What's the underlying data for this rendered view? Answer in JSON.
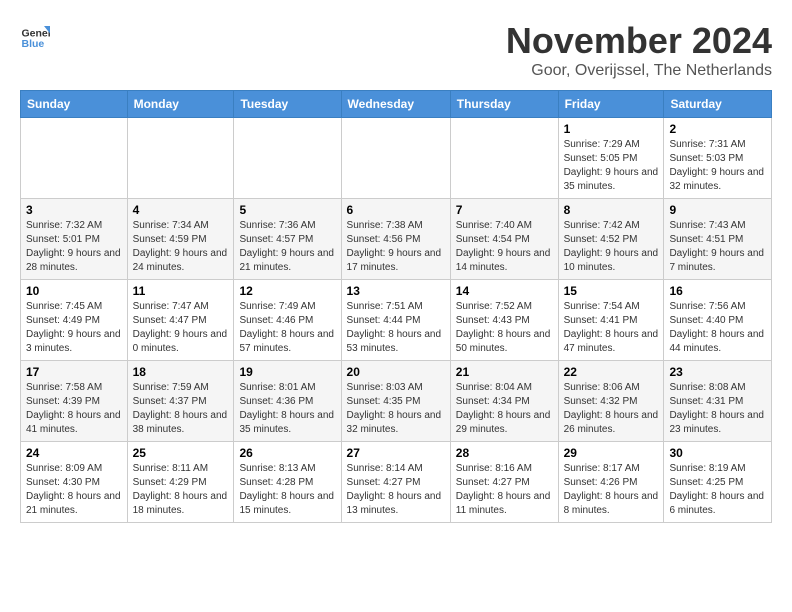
{
  "logo": {
    "text_general": "General",
    "text_blue": "Blue"
  },
  "header": {
    "month_year": "November 2024",
    "location": "Goor, Overijssel, The Netherlands"
  },
  "weekdays": [
    "Sunday",
    "Monday",
    "Tuesday",
    "Wednesday",
    "Thursday",
    "Friday",
    "Saturday"
  ],
  "weeks": [
    [
      {
        "day": "",
        "info": ""
      },
      {
        "day": "",
        "info": ""
      },
      {
        "day": "",
        "info": ""
      },
      {
        "day": "",
        "info": ""
      },
      {
        "day": "",
        "info": ""
      },
      {
        "day": "1",
        "info": "Sunrise: 7:29 AM\nSunset: 5:05 PM\nDaylight: 9 hours and 35 minutes."
      },
      {
        "day": "2",
        "info": "Sunrise: 7:31 AM\nSunset: 5:03 PM\nDaylight: 9 hours and 32 minutes."
      }
    ],
    [
      {
        "day": "3",
        "info": "Sunrise: 7:32 AM\nSunset: 5:01 PM\nDaylight: 9 hours and 28 minutes."
      },
      {
        "day": "4",
        "info": "Sunrise: 7:34 AM\nSunset: 4:59 PM\nDaylight: 9 hours and 24 minutes."
      },
      {
        "day": "5",
        "info": "Sunrise: 7:36 AM\nSunset: 4:57 PM\nDaylight: 9 hours and 21 minutes."
      },
      {
        "day": "6",
        "info": "Sunrise: 7:38 AM\nSunset: 4:56 PM\nDaylight: 9 hours and 17 minutes."
      },
      {
        "day": "7",
        "info": "Sunrise: 7:40 AM\nSunset: 4:54 PM\nDaylight: 9 hours and 14 minutes."
      },
      {
        "day": "8",
        "info": "Sunrise: 7:42 AM\nSunset: 4:52 PM\nDaylight: 9 hours and 10 minutes."
      },
      {
        "day": "9",
        "info": "Sunrise: 7:43 AM\nSunset: 4:51 PM\nDaylight: 9 hours and 7 minutes."
      }
    ],
    [
      {
        "day": "10",
        "info": "Sunrise: 7:45 AM\nSunset: 4:49 PM\nDaylight: 9 hours and 3 minutes."
      },
      {
        "day": "11",
        "info": "Sunrise: 7:47 AM\nSunset: 4:47 PM\nDaylight: 9 hours and 0 minutes."
      },
      {
        "day": "12",
        "info": "Sunrise: 7:49 AM\nSunset: 4:46 PM\nDaylight: 8 hours and 57 minutes."
      },
      {
        "day": "13",
        "info": "Sunrise: 7:51 AM\nSunset: 4:44 PM\nDaylight: 8 hours and 53 minutes."
      },
      {
        "day": "14",
        "info": "Sunrise: 7:52 AM\nSunset: 4:43 PM\nDaylight: 8 hours and 50 minutes."
      },
      {
        "day": "15",
        "info": "Sunrise: 7:54 AM\nSunset: 4:41 PM\nDaylight: 8 hours and 47 minutes."
      },
      {
        "day": "16",
        "info": "Sunrise: 7:56 AM\nSunset: 4:40 PM\nDaylight: 8 hours and 44 minutes."
      }
    ],
    [
      {
        "day": "17",
        "info": "Sunrise: 7:58 AM\nSunset: 4:39 PM\nDaylight: 8 hours and 41 minutes."
      },
      {
        "day": "18",
        "info": "Sunrise: 7:59 AM\nSunset: 4:37 PM\nDaylight: 8 hours and 38 minutes."
      },
      {
        "day": "19",
        "info": "Sunrise: 8:01 AM\nSunset: 4:36 PM\nDaylight: 8 hours and 35 minutes."
      },
      {
        "day": "20",
        "info": "Sunrise: 8:03 AM\nSunset: 4:35 PM\nDaylight: 8 hours and 32 minutes."
      },
      {
        "day": "21",
        "info": "Sunrise: 8:04 AM\nSunset: 4:34 PM\nDaylight: 8 hours and 29 minutes."
      },
      {
        "day": "22",
        "info": "Sunrise: 8:06 AM\nSunset: 4:32 PM\nDaylight: 8 hours and 26 minutes."
      },
      {
        "day": "23",
        "info": "Sunrise: 8:08 AM\nSunset: 4:31 PM\nDaylight: 8 hours and 23 minutes."
      }
    ],
    [
      {
        "day": "24",
        "info": "Sunrise: 8:09 AM\nSunset: 4:30 PM\nDaylight: 8 hours and 21 minutes."
      },
      {
        "day": "25",
        "info": "Sunrise: 8:11 AM\nSunset: 4:29 PM\nDaylight: 8 hours and 18 minutes."
      },
      {
        "day": "26",
        "info": "Sunrise: 8:13 AM\nSunset: 4:28 PM\nDaylight: 8 hours and 15 minutes."
      },
      {
        "day": "27",
        "info": "Sunrise: 8:14 AM\nSunset: 4:27 PM\nDaylight: 8 hours and 13 minutes."
      },
      {
        "day": "28",
        "info": "Sunrise: 8:16 AM\nSunset: 4:27 PM\nDaylight: 8 hours and 11 minutes."
      },
      {
        "day": "29",
        "info": "Sunrise: 8:17 AM\nSunset: 4:26 PM\nDaylight: 8 hours and 8 minutes."
      },
      {
        "day": "30",
        "info": "Sunrise: 8:19 AM\nSunset: 4:25 PM\nDaylight: 8 hours and 6 minutes."
      }
    ]
  ]
}
